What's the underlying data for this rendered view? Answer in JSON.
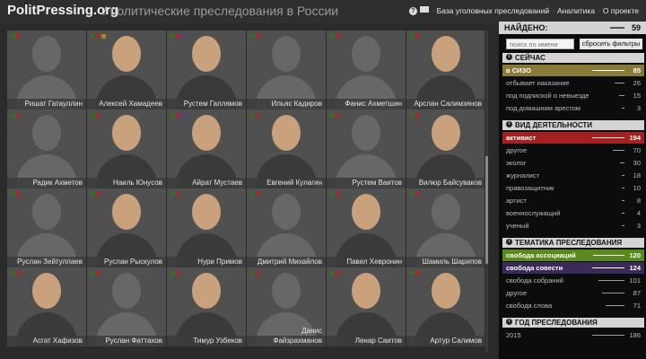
{
  "header": {
    "logo": "PolitPressing.org",
    "tagline": "/ политические преследования в России",
    "help_icon": "question-icon",
    "mail_icon": "mail-icon",
    "nav": [
      "База уголовных преследований",
      "Аналитика",
      "О проекте"
    ],
    "nav_separator": "·"
  },
  "colors": {
    "background": "#2b2b2b",
    "panel": "#0c0c0c",
    "sizo": "#8a7a3a",
    "activist": "#a52020",
    "association": "#5a8a1e",
    "conscience": "#3a2a5a",
    "flag_red": "#9b2f2f",
    "flag_green": "#3d6b2a",
    "flag_yellow": "#9a8a2a",
    "flag_purple": "#5a3c7a"
  },
  "grid": {
    "people": [
      {
        "name": "Ришат Гатауллин",
        "photo": false,
        "flags": [
          "#3d6b2a",
          "#9b2f2f"
        ]
      },
      {
        "name": "Алексей Хамадеев",
        "photo": true,
        "flags": [
          "#3d6b2a",
          "#9b2f2f",
          "#9a8a2a"
        ]
      },
      {
        "name": "Рустем Галлямов",
        "photo": true,
        "flags": [
          "#3d6b2a",
          "#9b2f2f",
          "#5a3c7a"
        ]
      },
      {
        "name": "Ильяс Кадиров",
        "photo": false,
        "flags": [
          "#3d6b2a",
          "#9b2f2f"
        ]
      },
      {
        "name": "Фанис Ахметшин",
        "photo": false,
        "flags": [
          "#3d6b2a",
          "#9b2f2f"
        ]
      },
      {
        "name": "Арслан Салимзянов",
        "photo": true,
        "flags": [
          "#3d6b2a",
          "#9b2f2f"
        ]
      },
      {
        "name": "Радик Ахметов",
        "photo": false,
        "flags": [
          "#3d6b2a",
          "#9b2f2f"
        ]
      },
      {
        "name": "Наиль Юнусов",
        "photo": true,
        "flags": [
          "#3d6b2a",
          "#9b2f2f"
        ]
      },
      {
        "name": "Айрат Мустаев",
        "photo": true,
        "flags": [
          "#3d6b2a",
          "#9b2f2f",
          "#5a3c7a"
        ]
      },
      {
        "name": "Евгений Кулагин",
        "photo": true,
        "flags": [
          "#3d6b2a",
          "#9b2f2f"
        ]
      },
      {
        "name": "Рустем Ваитов",
        "photo": false,
        "flags": [
          "#3d6b2a",
          "#9b2f2f"
        ]
      },
      {
        "name": "Вилюр Байсуваков",
        "photo": true,
        "flags": [
          "#3d6b2a",
          "#9b2f2f"
        ]
      },
      {
        "name": "Руслан Зейтуллаев",
        "photo": false,
        "flags": [
          "#3d6b2a",
          "#9b2f2f"
        ]
      },
      {
        "name": "Руслан Рыскулов",
        "photo": true,
        "flags": [
          "#3d6b2a",
          "#9b2f2f"
        ]
      },
      {
        "name": "Нури Примов",
        "photo": true,
        "flags": [
          "#3d6b2a",
          "#9b2f2f"
        ]
      },
      {
        "name": "Дмитрий Михайлов",
        "photo": false,
        "flags": [
          "#3d6b2a",
          "#9b2f2f"
        ]
      },
      {
        "name": "Павел Хевронин",
        "photo": true,
        "flags": [
          "#3d6b2a",
          "#9b2f2f"
        ]
      },
      {
        "name": "Шамиль Шарипов",
        "photo": false,
        "flags": [
          "#3d6b2a",
          "#9b2f2f"
        ]
      },
      {
        "name": "Асгат Хафизов",
        "photo": true,
        "flags": [
          "#3d6b2a",
          "#9b2f2f"
        ]
      },
      {
        "name": "Руслан Фаттахов",
        "photo": false,
        "flags": [
          "#3d6b2a",
          "#9b2f2f"
        ]
      },
      {
        "name": "Тимур Узбеков",
        "photo": true,
        "flags": [
          "#3d6b2a",
          "#9b2f2f"
        ]
      },
      {
        "name": "Файзрахманов",
        "name_line1": "Данис",
        "photo": false,
        "flags": [
          "#3d6b2a",
          "#9b2f2f"
        ]
      },
      {
        "name": "Ленар Саитов",
        "photo": true,
        "flags": [
          "#3d6b2a",
          "#9b2f2f"
        ]
      },
      {
        "name": "Артур Салимов",
        "photo": true,
        "flags": [
          "#3d6b2a",
          "#9b2f2f"
        ]
      }
    ]
  },
  "panel": {
    "found_label": "НАЙДЕНО:",
    "found_count": "59",
    "search_placeholder": "поиск по имени",
    "reset_label": "сбросить фильтры",
    "info_icon": "info-icon",
    "sections": [
      {
        "title": "СЕЙЧАС",
        "rows": [
          {
            "label": "в СИЗО",
            "count": "85",
            "fraction": 1.0,
            "highlight": "#8a7a3a"
          },
          {
            "label": "отбывает наказание",
            "count": "26",
            "fraction": 0.31
          },
          {
            "label": "под подпиской о невыезде",
            "count": "15",
            "fraction": 0.18
          },
          {
            "label": "под домашним арестом",
            "count": "3",
            "fraction": 0.04
          }
        ]
      },
      {
        "title": "ВИД ДЕЯТЕЛЬНОСТИ",
        "rows": [
          {
            "label": "активист",
            "count": "194",
            "fraction": 1.0,
            "highlight": "#a52020"
          },
          {
            "label": "другое",
            "count": "70",
            "fraction": 0.36
          },
          {
            "label": "эколог",
            "count": "30",
            "fraction": 0.15
          },
          {
            "label": "журналист",
            "count": "18",
            "fraction": 0.09
          },
          {
            "label": "правозащитник",
            "count": "10",
            "fraction": 0.05
          },
          {
            "label": "артист",
            "count": "8",
            "fraction": 0.04
          },
          {
            "label": "военнослужащий",
            "count": "4",
            "fraction": 0.02
          },
          {
            "label": "ученый",
            "count": "3",
            "fraction": 0.015
          }
        ]
      },
      {
        "title": "ТЕМАТИКА ПРЕСЛЕДОВАНИЯ",
        "rows": [
          {
            "label": "свобода ассоциаций",
            "count": "120",
            "fraction": 0.97,
            "highlight": "#5a8a1e"
          },
          {
            "label": "свобода совести",
            "count": "124",
            "fraction": 1.0,
            "highlight": "#3a2a5a"
          },
          {
            "label": "свобода собраний",
            "count": "101",
            "fraction": 0.81
          },
          {
            "label": "другое",
            "count": "87",
            "fraction": 0.7
          },
          {
            "label": "свобода слова",
            "count": "71",
            "fraction": 0.57
          }
        ]
      },
      {
        "title": "ГОД ПРЕСЛЕДОВАНИЯ",
        "rows": [
          {
            "label": "2015",
            "count": "186",
            "fraction": 1.0
          }
        ]
      }
    ]
  }
}
